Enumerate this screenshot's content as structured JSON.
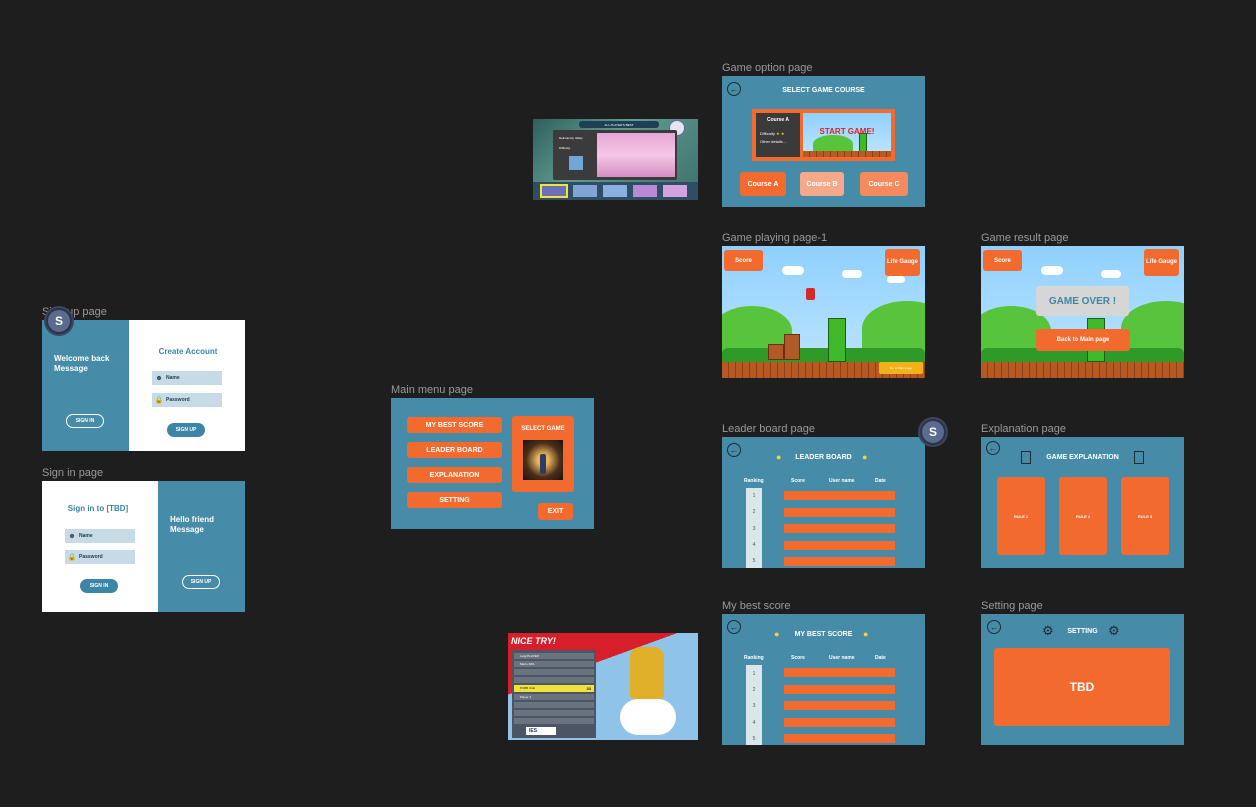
{
  "labels": {
    "signup": "Sign up page",
    "signin": "Sign in page",
    "main_menu": "Main menu page",
    "game_option": "Game option page",
    "game_playing": "Game playing page-1",
    "game_result": "Game result page",
    "leader_board": "Leader board page",
    "explanation": "Explanation page",
    "my_best": "My best score",
    "setting": "Setting page"
  },
  "avatars": {
    "a1": "S",
    "a2": "S"
  },
  "signup": {
    "welcome": "Welcome back Message",
    "signin_btn": "SIGN IN",
    "title": "Create Account",
    "name": "Name",
    "password": "Password",
    "signup_btn": "SIGN UP"
  },
  "signin": {
    "title": "Sign in to [TBD]",
    "name": "Name",
    "password": "Password",
    "signin_btn": "SIGN IN",
    "hello": "Hello friend Message",
    "signup_btn": "SIGN UP"
  },
  "main_menu": {
    "buttons": [
      "MY BEST SCORE",
      "LEADER BOARD",
      "EXPLANATION",
      "SETTING"
    ],
    "select_game": "SELECT GAME",
    "exit": "EXIT"
  },
  "game_option": {
    "title": "SELECT GAME COURSE",
    "course_title": "Course A",
    "difficulty": "Difficulty",
    "stars": "★ ★",
    "other": "Other details...",
    "start": "START GAME!",
    "courses": [
      "Course A",
      "Course B",
      "Course C"
    ]
  },
  "game_playing": {
    "score": "Score",
    "life": "Life Gauge",
    "corner": "Go to Main page"
  },
  "game_result": {
    "score": "Score",
    "life": "Life Gauge",
    "over": "GAME OVER !",
    "back": "Back to Main page"
  },
  "leader_board": {
    "title": "LEADER BOARD",
    "columns": [
      "Ranking",
      "Score",
      "User name",
      "Date"
    ],
    "ranks": [
      "1",
      "2",
      "3",
      "4",
      "5"
    ]
  },
  "explanation": {
    "title": "GAME EXPLANATION",
    "rules": [
      "RULE 1",
      "RULE 2",
      "RULE 3"
    ]
  },
  "my_best": {
    "title": "MY BEST SCORE",
    "columns": [
      "Ranking",
      "Score",
      "User name",
      "Date"
    ],
    "ranks": [
      "1",
      "2",
      "3",
      "4",
      "5"
    ]
  },
  "setting": {
    "title": "SETTING",
    "tbd": "TBD"
  },
  "screenshot1": {
    "header": "ALL PLAYER'S BEST",
    "panel_title": "Delimanoty Valley",
    "difficulty": "Difficulty"
  },
  "screenshot2": {
    "banner": "NICE TRY!",
    "rows": [
      "Luigi PLAYER",
      "Mario 33%",
      "PUBB Club",
      "Player 4"
    ],
    "highlight_score": "33",
    "footer": "IES"
  },
  "colors": {
    "teal": "#468ca9",
    "orange": "#f26a2e",
    "canvas": "#1e1e1e"
  }
}
